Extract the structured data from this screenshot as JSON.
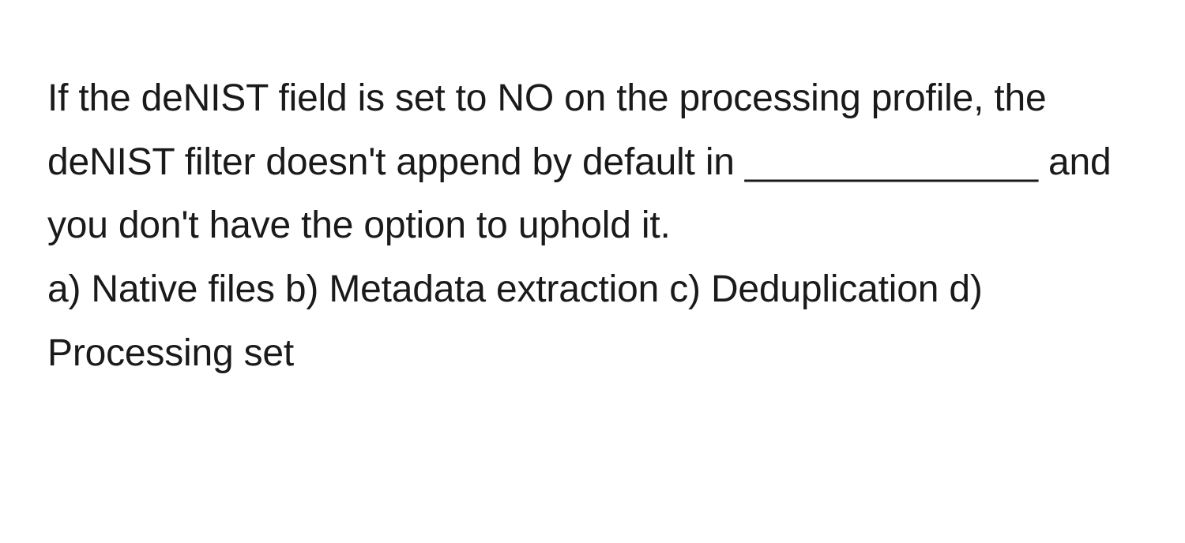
{
  "question": {
    "stem": "If the deNIST field is set to NO on the processing profile, the deNIST filter doesn't append by default in ______________ and you don't have the option to uphold it.",
    "options_line": "a) Native files b) Metadata extraction c) Deduplication d) Processing set"
  }
}
